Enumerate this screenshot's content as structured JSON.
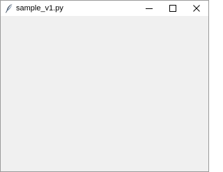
{
  "window": {
    "title": "sample_v1.py",
    "app_icon": "tk-feather-icon",
    "controls": {
      "minimize_icon": "minimize-icon",
      "maximize_icon": "maximize-icon",
      "close_icon": "close-icon"
    }
  },
  "colors": {
    "titlebar_bg": "#ffffff",
    "client_bg": "#f0f0f0",
    "border": "#9a9a9a",
    "glyph": "#000000"
  }
}
